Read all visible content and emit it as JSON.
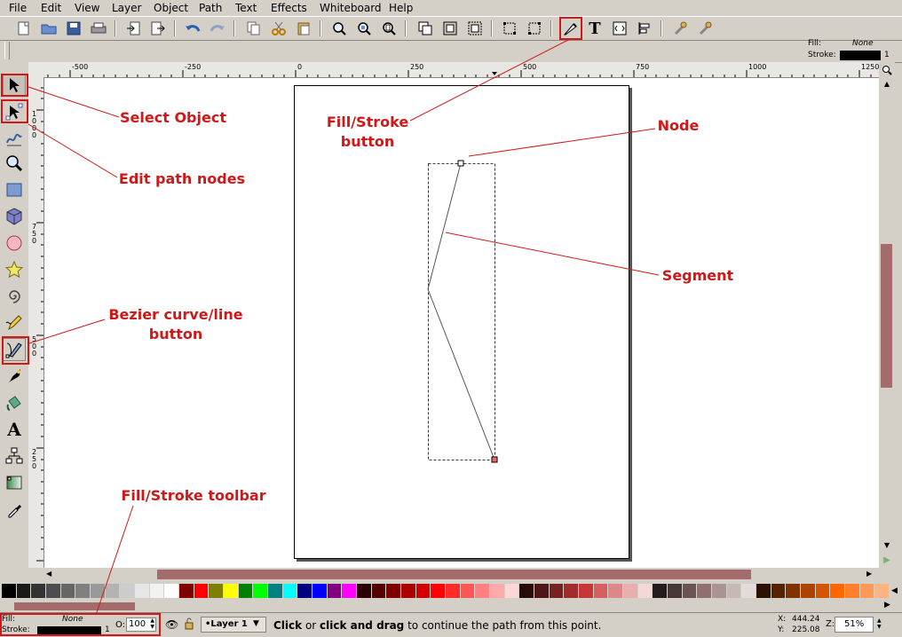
{
  "menubar": {
    "items": [
      "File",
      "Edit",
      "View",
      "Layer",
      "Object",
      "Path",
      "Text",
      "Effects",
      "Whiteboard",
      "Help"
    ]
  },
  "command_bar": {
    "icons": [
      "new-icon",
      "open-icon",
      "save-icon",
      "print-icon",
      "import-icon",
      "export-icon",
      "undo-icon",
      "redo-icon",
      "copy-icon",
      "cut-icon",
      "paste-icon",
      "zoom-selection-icon",
      "zoom-drawing-icon",
      "zoom-page-icon",
      "duplicate-icon",
      "group-icon",
      "ungroup-icon",
      "snap-icon",
      "snap-nodes-icon",
      "fill-stroke-icon",
      "text-tool-icon",
      "xml-editor-icon",
      "align-icon",
      "preferences-icon",
      "document-properties-icon"
    ],
    "text_tool_glyph": "T"
  },
  "fill_stroke_indicator": {
    "fill_label": "Fill:",
    "fill_value": "None",
    "stroke_label": "Stroke:",
    "stroke_width": "1"
  },
  "ruler_h": {
    "labels": [
      "-500",
      "-250",
      "0",
      "250",
      "500",
      "750",
      "1000",
      "1250"
    ]
  },
  "ruler_v": {
    "labels": [
      "1000",
      "750",
      "500",
      "250"
    ]
  },
  "toolbox": {
    "tools": [
      "selector-tool",
      "node-tool",
      "tweak-tool",
      "zoom-tool",
      "rectangle-tool",
      "3d-box-tool",
      "ellipse-tool",
      "star-tool",
      "spiral-tool",
      "pencil-tool",
      "bezier-tool",
      "calligraphy-tool",
      "paint-bucket-tool",
      "text-tool",
      "connector-tool",
      "gradient-tool",
      "dropper-tool"
    ],
    "text_glyph": "A"
  },
  "palette": {
    "colors": [
      "#000000",
      "#1a1a1a",
      "#333333",
      "#4d4d4d",
      "#666666",
      "#808080",
      "#999999",
      "#b3b3b3",
      "#cccccc",
      "#e6e6e6",
      "#f2f2f2",
      "#ffffff",
      "#800000",
      "#ff0000",
      "#808000",
      "#ffff00",
      "#008000",
      "#00ff00",
      "#008080",
      "#00ffff",
      "#000080",
      "#0000ff",
      "#800080",
      "#ff00ff",
      "#2b0000",
      "#550000",
      "#800000",
      "#aa0000",
      "#d40000",
      "#ff0000",
      "#ff2a2a",
      "#ff5555",
      "#ff8080",
      "#ffaaaa",
      "#ffd5d5",
      "#280b0b",
      "#501616",
      "#782121",
      "#a02c2c",
      "#c83737",
      "#d35f5f",
      "#de8787",
      "#e9afaf",
      "#f4d7d7",
      "#241c1c",
      "#483737",
      "#6c5353",
      "#916f6f",
      "#ac9393",
      "#c8b7b7",
      "#e3dbdb",
      "#2b1100",
      "#552200",
      "#803300",
      "#aa4400",
      "#d45500",
      "#ff6600",
      "#ff7f2a",
      "#ff9955",
      "#ffb380"
    ]
  },
  "status": {
    "fill_label": "Fill:",
    "fill_value": "None",
    "stroke_label": "Stroke:",
    "stroke_width": "1",
    "opacity_label": "O:",
    "opacity_value": "100",
    "layer_name": "•Layer 1",
    "message_bold_1": "Click",
    "message_or": " or ",
    "message_bold_2": "click and drag",
    "message_rest": " to continue the path from this point.",
    "x_label": "X:",
    "x_value": "444.24",
    "y_label": "Y:",
    "y_value": "225.08",
    "zoom_label": "Z:",
    "zoom_value": "51%"
  },
  "annotations": {
    "select_object": "Select Object",
    "edit_path_nodes": "Edit path nodes",
    "bezier_line1": "Bezier curve/line",
    "bezier_line2": "button",
    "fill_stroke_toolbar": "Fill/Stroke toolbar",
    "fill_stroke_button_line1": "Fill/Stroke",
    "fill_stroke_button_line2": "button",
    "node": "Node",
    "segment": "Segment"
  },
  "colors": {
    "annotation": "#d01818",
    "scroll_thumb": "#a36b6b"
  }
}
